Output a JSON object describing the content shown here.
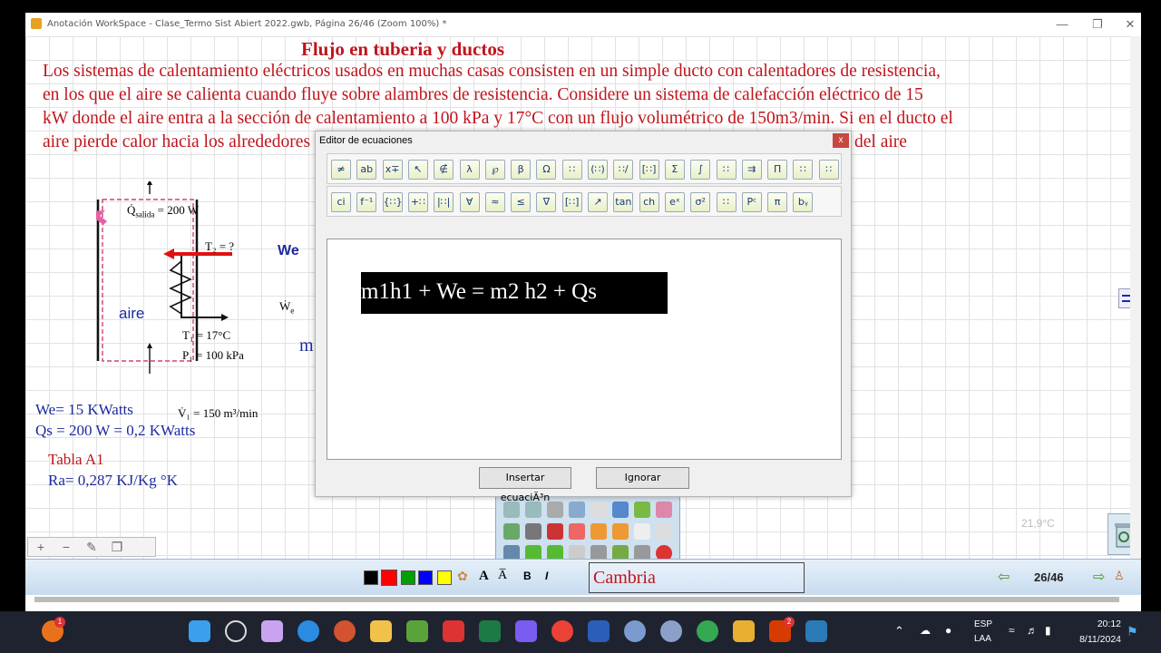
{
  "window": {
    "title": "Anotación WorkSpace - Clase_Termo Sist Abiert 2022.gwb, Página 26/46  (Zoom 100%) *",
    "minimize": "—",
    "maximize": "❐",
    "close": "✕"
  },
  "document": {
    "heading": "Flujo en tuberia y ductos",
    "lines": [
      "Los sistemas de calentamiento eléctricos usados en muchas casas consisten en un simple ducto con calentadores de resistencia,",
      "en los que el aire se calienta cuando fluye sobre alambres de resistencia. Considere un sistema de calefacción eléctrico de 15",
      "kW donde el aire entra a la sección de calentamiento a 100 kPa y 17°C con un flujo volumétrico de 150m3/min. Si en el ducto el",
      "aire pierde calor hacia los alrededores"
    ],
    "line4_tail": "del aire",
    "diagram": {
      "q_out": "Q̇",
      "q_out_sub": "salida",
      "q_out_val": "= 200 W",
      "t2": "T₂ = ?",
      "we_hand": "We",
      "we_dot": "Ẇ",
      "we_sub": "e",
      "aire": "aire",
      "t1": "T₁ = 17°C",
      "p1": "P₁ = 100 kPa",
      "v1": "V̇₁ = 150 m³/min"
    },
    "notes": {
      "we": "We= 15 KWatts",
      "qs": "Qs = 200 W = 0,2 KWatts",
      "tabla": "Tabla A1",
      "ra": "Ra= 0,287 KJ/Kg °K"
    },
    "m_fragment": "m",
    "temp_watermark": "21,9°C"
  },
  "equation_editor": {
    "title": "Editor de ecuaciones",
    "close": "x",
    "row1_icons": [
      "≠",
      "ab",
      "x∓",
      "↖",
      "∉",
      "λ",
      "℘",
      "β",
      "Ω",
      "∷",
      "(∷)",
      "∷/",
      "[∷]",
      "Σ",
      "∫",
      "∷",
      "⇉",
      "Π",
      "∷",
      "∷"
    ],
    "row2_icons": [
      "ci",
      "f⁻¹",
      "{∷}",
      "+∷",
      "|∷|",
      "∀",
      "≈",
      "≤",
      "∇",
      "[∷]",
      "↗",
      "tan",
      "ch",
      "eˣ",
      "σ²",
      "∷",
      "Pᶜ",
      "π",
      "bᵧ"
    ],
    "equation": "m1h1 + We = m2 h2 + Qs",
    "insert_button": "Insertar ecuaciÃ³n",
    "ignore_button": "Ignorar"
  },
  "bottombar": {
    "colors": [
      "#000000",
      "#ff0000",
      "#00a000",
      "#0000ff",
      "#ffff00"
    ],
    "font_label": "A",
    "font_label2": "A̅",
    "bold": "B",
    "italic": "I",
    "font_name": "Cambria",
    "page": "26/46"
  },
  "taskbar": {
    "lang": "ESP",
    "lang2": "LAA",
    "time": "20:12",
    "date": "8/11/2024",
    "badge_orange": "1",
    "badge_zm": "2"
  }
}
